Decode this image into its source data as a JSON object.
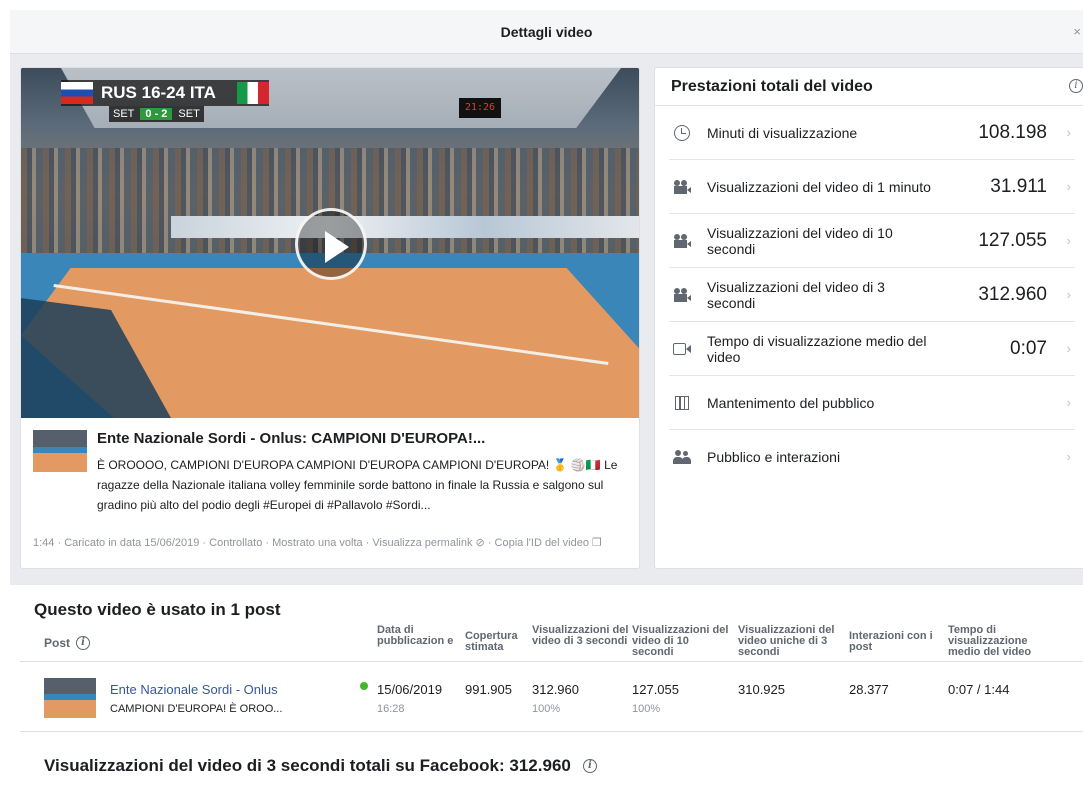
{
  "header": {
    "title": "Dettagli video"
  },
  "video": {
    "scoreboard": {
      "score_text": "RUS 16-24 ITA",
      "set_label": "SET",
      "set_score": "0 - 2",
      "set_label_right": "SET"
    },
    "arena_board": "21:26",
    "post_title": "Ente Nazionale Sordi - Onlus: CAMPIONI D'EUROPA!...",
    "post_description": "È OROOOO, CAMPIONI D'EUROPA CAMPIONI D'EUROPA CAMPIONI D'EUROPA! 🥇 🏐🇮🇹 Le ragazze della Nazionale italiana volley femminile sorde battono in finale la Russia e salgono sul gradino più alto del podio degli #Europei di #Pallavolo #Sordi...",
    "meta": {
      "duration": "1:44",
      "uploaded": "Caricato in data 15/06/2019",
      "checked": "Controllato",
      "shown": "Mostrato una volta",
      "permalink": "Visualizza permalink",
      "copy_id": "Copia l'ID del video"
    }
  },
  "performance": {
    "title": "Prestazioni totali del video",
    "metrics": [
      {
        "label": "Minuti di visualizzazione",
        "value": "108.198",
        "icon": "clock-icon"
      },
      {
        "label": "Visualizzazioni del video di 1 minuto",
        "value": "31.911",
        "icon": "camera-icon"
      },
      {
        "label": "Visualizzazioni del video di 10 secondi",
        "value": "127.055",
        "icon": "camera-icon"
      },
      {
        "label": "Visualizzazioni del video di 3 secondi",
        "value": "312.960",
        "icon": "camera-icon"
      },
      {
        "label": "Tempo di visualizzazione medio del video",
        "value": "0:07",
        "icon": "video-icon"
      },
      {
        "label": "Mantenimento del pubblico",
        "value": "",
        "icon": "film-icon"
      },
      {
        "label": "Pubblico e interazioni",
        "value": "",
        "icon": "people-icon"
      }
    ]
  },
  "posts_section": {
    "title": "Questo video è usato in 1 post",
    "columns": {
      "post": "Post",
      "date": "Data di pubblicazion e",
      "reach": "Copertura stimata",
      "views3": "Visualizzazioni del video di 3 secondi",
      "views10": "Visualizzazioni del video di 10 secondi",
      "unique3": "Visualizzazioni del video uniche di 3 secondi",
      "interactions": "Interazioni con i post",
      "watch_time": "Tempo di visualizzazione medio del video"
    },
    "row": {
      "name": "Ente Nazionale Sordi - Onlus",
      "subtitle": "CAMPIONI D'EUROPA! È OROO...",
      "date": "15/06/2019",
      "time": "16:28",
      "reach": "991.905",
      "views3": "312.960",
      "views3_pct": "100%",
      "views10": "127.055",
      "views10_pct": "100%",
      "unique3": "310.925",
      "interactions": "28.377",
      "watch_time": "0:07 / 1:44"
    }
  },
  "total": {
    "text": "Visualizzazioni del video di 3 secondi totali su Facebook: 312.960"
  },
  "colors": {
    "link": "#365899",
    "status_green": "#42b72a",
    "page_gray": "#e9ebee"
  }
}
